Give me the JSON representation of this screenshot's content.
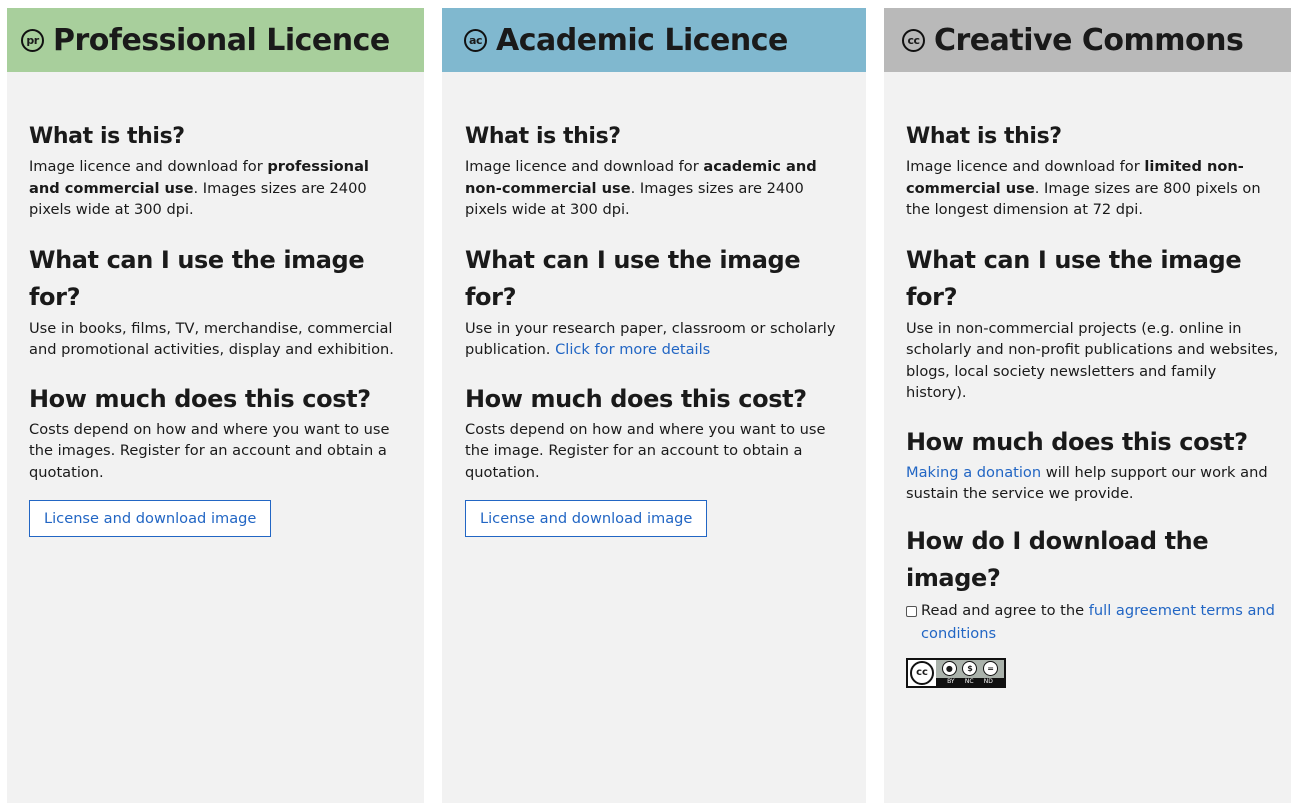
{
  "colors": {
    "professional_header": "#a8cf9c",
    "academic_header": "#80b8cf",
    "creative_header": "#b9b9b9",
    "panel_background": "#f2f2f2",
    "link": "#2266c4"
  },
  "professional": {
    "badge": "pr",
    "title": "Professional Licence",
    "what_heading": "What is this?",
    "what_text_1": "Image licence and download for ",
    "what_text_bold": "professional and commercial use",
    "what_text_2": ". Images sizes are 2400 pixels wide at 300 dpi.",
    "use_heading": "What can I use the image for?",
    "use_text": "Use in books, films, TV, merchandise, commercial and promotional activities, display and exhibition.",
    "cost_heading": "How much does this cost?",
    "cost_text": "Costs depend on how and where you want to use the images. Register for an account and obtain a quotation.",
    "button_label": "License and download image"
  },
  "academic": {
    "badge": "ac",
    "title": "Academic Licence",
    "what_heading": "What is this?",
    "what_text_1": "Image licence and download for ",
    "what_text_bold": "academic and non-commercial use",
    "what_text_2": ". Images sizes are 2400 pixels wide at 300 dpi.",
    "use_heading": "What can I use the image for?",
    "use_text": "Use in your research paper, classroom or scholarly publication. ",
    "use_link": "Click for more details",
    "cost_heading": "How much does this cost?",
    "cost_text": "Costs depend on how and where you want to use the image. Register for an account to obtain a quotation.",
    "button_label": "License and download image"
  },
  "creative": {
    "badge": "cc",
    "title": "Creative Commons",
    "what_heading": "What is this?",
    "what_text_1": "Image licence and download for ",
    "what_text_bold": "limited non-commercial use",
    "what_text_2": ". Image sizes are 800 pixels on the longest dimension at 72 dpi.",
    "use_heading": "What can I use the image for?",
    "use_text": "Use in non-commercial projects (e.g. online in scholarly and non-profit publications and websites, blogs, local society newsletters and family history).",
    "cost_heading": "How much does this cost?",
    "cost_link": "Making a donation",
    "cost_text": " will help support our work and sustain the service we provide.",
    "download_heading": "How do I download the image?",
    "agree_text": "Read and agree to the ",
    "agree_link": "full agreement terms and conditions",
    "cc_logo": {
      "main": "cc",
      "icons": [
        "attribution-icon",
        "non-commercial-icon",
        "no-derivatives-icon"
      ],
      "labels": [
        "BY",
        "NC",
        "ND"
      ]
    }
  }
}
